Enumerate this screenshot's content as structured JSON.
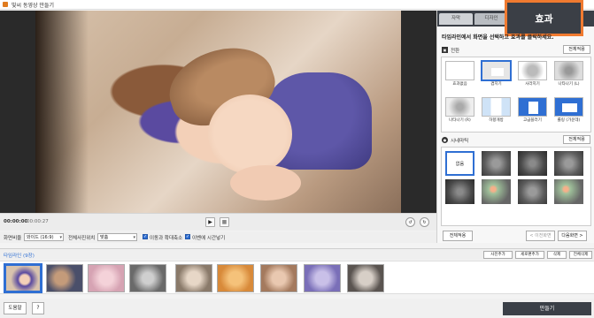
{
  "window": {
    "title": "빛씨 동영상 만들기"
  },
  "player": {
    "current_time": "00:00:00",
    "total_time": "00:00:27",
    "play_label": "▶",
    "stop_label": "■"
  },
  "options": {
    "ratio_label": "화면비율",
    "ratio_value": "와이드 (16:9)",
    "position_label": "전체사진위치",
    "position_value": "맞춤",
    "move_zoom_label": "이동과 확대축소",
    "show_time_label": "이벤에 시간넣기"
  },
  "tabs": {
    "subtitle": "자막",
    "design": "디자인",
    "effect": "효과"
  },
  "panel": {
    "hint": "타임라인에서 화면을 선택하고 효과를 클릭하세요.",
    "transition_title": "전환",
    "filter_title": "시네마틱",
    "apply_all": "전체적용",
    "transitions": [
      "효과없음",
      "겹치기",
      "사라지기",
      "나타나기 (L)",
      "나타나기 (R)",
      "하향개방",
      "고급블러기",
      "롤링 (가운데)"
    ],
    "filter_none": "없음",
    "apply_all_bottom": "전체적용",
    "prev_screen": "< 이전화면",
    "next_screen": "다음화면 >"
  },
  "timeline": {
    "title": "타임라인 (9장)",
    "add_photo": "사진추가",
    "add_chapter": "세로편추가",
    "delete": "삭제",
    "delete_all": "전체삭제"
  },
  "bottom": {
    "help": "도움말",
    "question": "?",
    "make": "만들기"
  }
}
